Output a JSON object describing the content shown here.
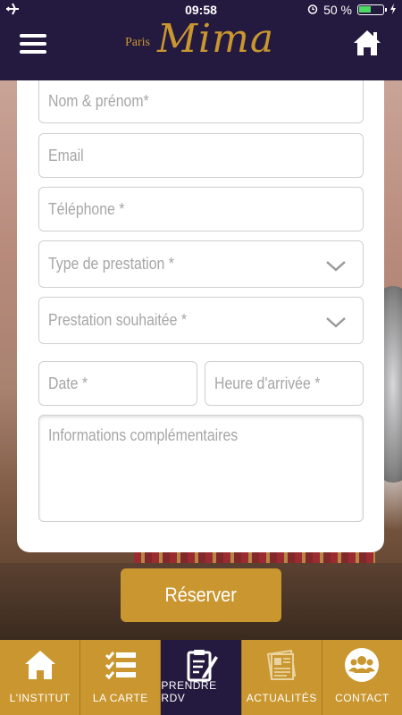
{
  "status_bar": {
    "time": "09:58",
    "battery": "50 %",
    "battery_level": 0.5
  },
  "header": {
    "logo_paris": "Paris",
    "logo_name": "Mima"
  },
  "form": {
    "name_placeholder": "Nom & prénom*",
    "email_placeholder": "Email",
    "phone_placeholder": "Téléphone *",
    "service_type_placeholder": "Type de prestation *",
    "service_wanted_placeholder": "Prestation souhaitée *",
    "date_placeholder": "Date *",
    "arrival_time_placeholder": "Heure d'arrivée *",
    "info_placeholder": "Informations complémentaires"
  },
  "reserve_label": "Réserver",
  "nav": {
    "items": [
      {
        "label": "L'INSTITUT",
        "icon": "home-icon"
      },
      {
        "label": "LA CARTE",
        "icon": "list-icon"
      },
      {
        "label": "PRENDRE RDV",
        "icon": "clipboard-icon",
        "active": true
      },
      {
        "label": "ACTUALITÉS",
        "icon": "newspaper-icon"
      },
      {
        "label": "CONTACT",
        "icon": "group-icon"
      }
    ]
  },
  "colors": {
    "header_bg": "#241a3f",
    "accent_gold": "#c9962f"
  }
}
